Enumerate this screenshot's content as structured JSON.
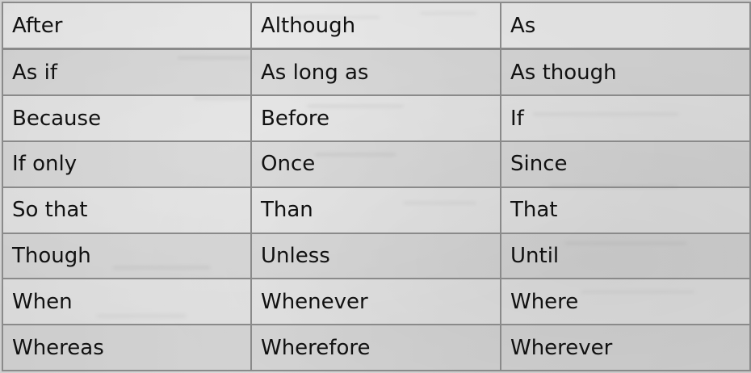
{
  "table": {
    "rows": [
      [
        "After",
        "Although",
        "As"
      ],
      [
        "As if",
        "As long as",
        "As though"
      ],
      [
        "Because",
        "Before",
        "If"
      ],
      [
        "If only",
        "Once",
        "Since"
      ],
      [
        "So that",
        "Than",
        "That"
      ],
      [
        "Though",
        "Unless",
        "Until"
      ],
      [
        "When",
        "Whenever",
        "Where"
      ],
      [
        "Whereas",
        "Wherefore",
        "Wherever"
      ]
    ]
  }
}
